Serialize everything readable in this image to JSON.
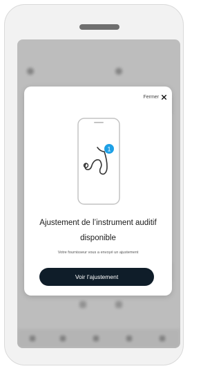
{
  "modal": {
    "close_label": "Fermer",
    "badge_count": "1",
    "title": "Ajustement de l’instrument auditif disponible",
    "subtitle": "Votre fournisseur vous a envoyé un ajustement",
    "cta_label": "Voir l’ajustement"
  },
  "colors": {
    "cta_background": "#0f1d29",
    "badge": "#1ea0e6",
    "background_screen": "#cfcfcf"
  },
  "icons": {
    "close": "close-icon",
    "hearing_aid": "hearing-aid-icon"
  }
}
